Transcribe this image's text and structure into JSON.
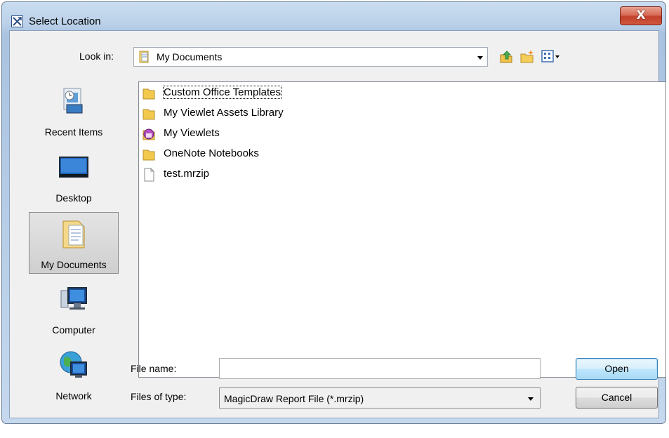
{
  "window": {
    "title": "Select Location",
    "close_glyph": "X"
  },
  "toolbar": {
    "look_in_label": "Look in:",
    "look_in_value": "My Documents",
    "up_icon": "up-folder-icon",
    "new_folder_icon": "new-folder-icon",
    "view_menu_icon": "view-menu-icon"
  },
  "sidebar": {
    "items": [
      {
        "label": "Recent Items",
        "icon": "recent-items-icon"
      },
      {
        "label": "Desktop",
        "icon": "desktop-icon"
      },
      {
        "label": "My Documents",
        "icon": "my-documents-icon",
        "selected": true
      },
      {
        "label": "Computer",
        "icon": "computer-icon"
      },
      {
        "label": "Network",
        "icon": "network-icon"
      }
    ]
  },
  "files": [
    {
      "name": "Custom Office Templates",
      "type": "folder",
      "focused": true
    },
    {
      "name": "My Viewlet Assets Library",
      "type": "folder"
    },
    {
      "name": "My Viewlets",
      "type": "viewlet-folder"
    },
    {
      "name": "OneNote Notebooks",
      "type": "folder"
    },
    {
      "name": "test.mrzip",
      "type": "file"
    }
  ],
  "form": {
    "file_name_label": "File name:",
    "file_name_value": "",
    "files_of_type_label": "Files of type:",
    "files_of_type_value": "MagicDraw Report File (*.mrzip)"
  },
  "buttons": {
    "open": "Open",
    "cancel": "Cancel"
  },
  "colors": {
    "selection_border": "#3c7fb1",
    "close_button": "#c2412a",
    "folder": "#f2c94c"
  }
}
